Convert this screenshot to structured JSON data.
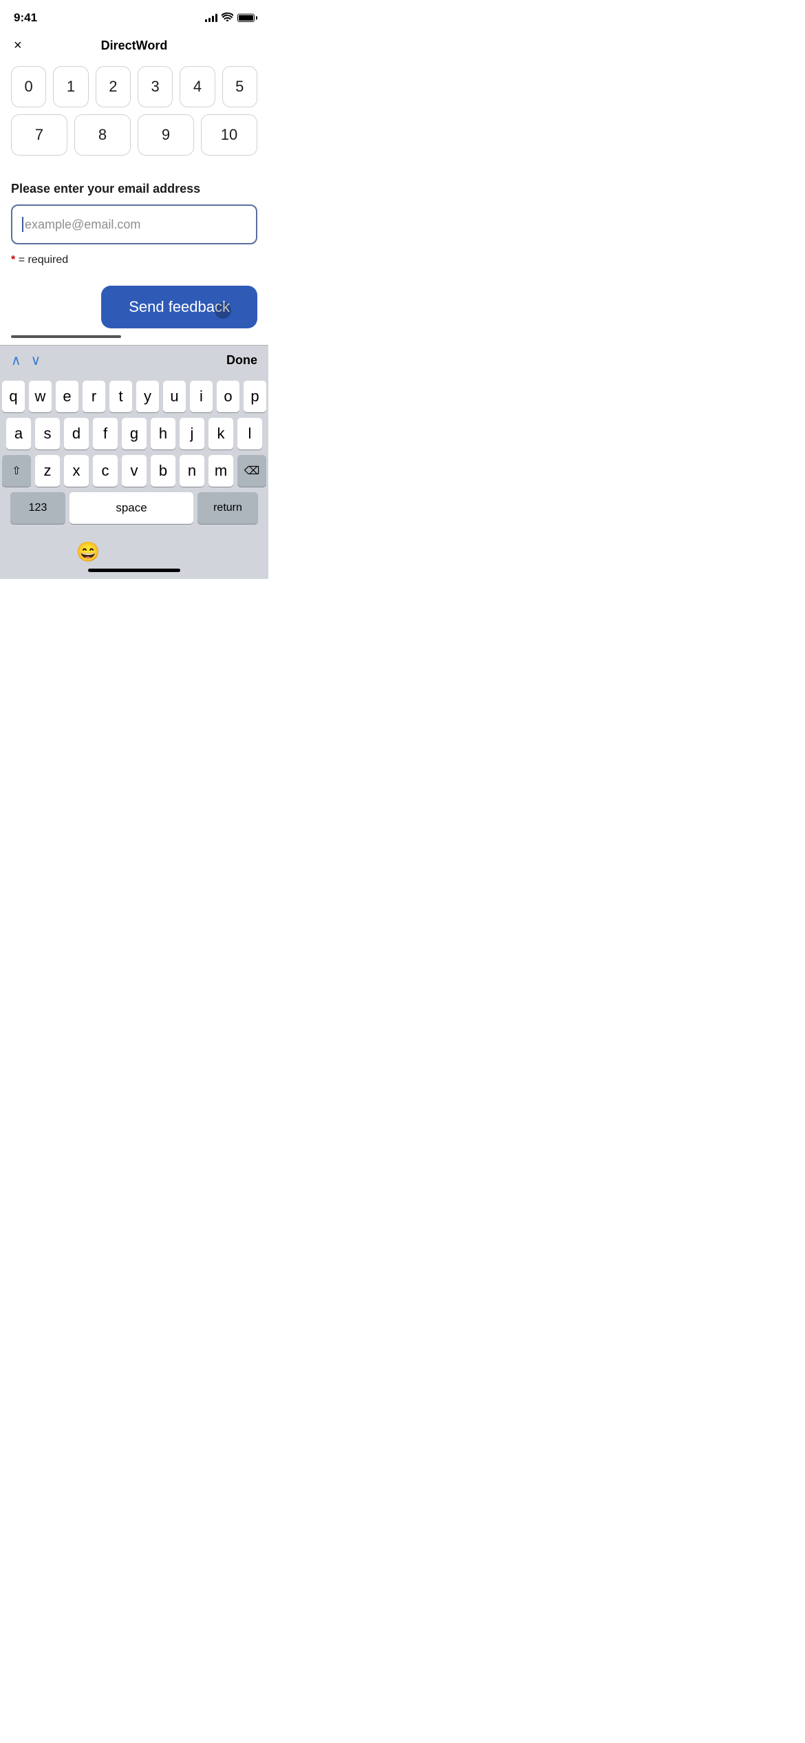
{
  "statusBar": {
    "time": "9:41",
    "signalBars": [
      4,
      6,
      8,
      10,
      12
    ],
    "batteryFull": true
  },
  "header": {
    "title": "DirectWord",
    "closeLabel": "×"
  },
  "numberGrid": {
    "rows": [
      [
        "0",
        "1",
        "2",
        "3",
        "4",
        "5"
      ],
      [
        "7",
        "8",
        "9",
        "10"
      ]
    ]
  },
  "emailSection": {
    "label": "Please enter your email address",
    "placeholder": "example@email.com",
    "requiredNote": "= required"
  },
  "sendButton": {
    "label": "Send feedback"
  },
  "keyboardToolbar": {
    "upArrow": "∧",
    "downArrow": "∨",
    "doneLabel": "Done"
  },
  "keyboard": {
    "rows": [
      [
        "q",
        "w",
        "e",
        "r",
        "t",
        "y",
        "u",
        "i",
        "o",
        "p"
      ],
      [
        "a",
        "s",
        "d",
        "f",
        "g",
        "h",
        "j",
        "k",
        "l"
      ],
      [
        "z",
        "x",
        "c",
        "v",
        "b",
        "n",
        "m"
      ]
    ],
    "specialKeys": {
      "shift": "⇧",
      "delete": "⌫",
      "numbers": "123",
      "space": "space",
      "return": "return"
    }
  }
}
